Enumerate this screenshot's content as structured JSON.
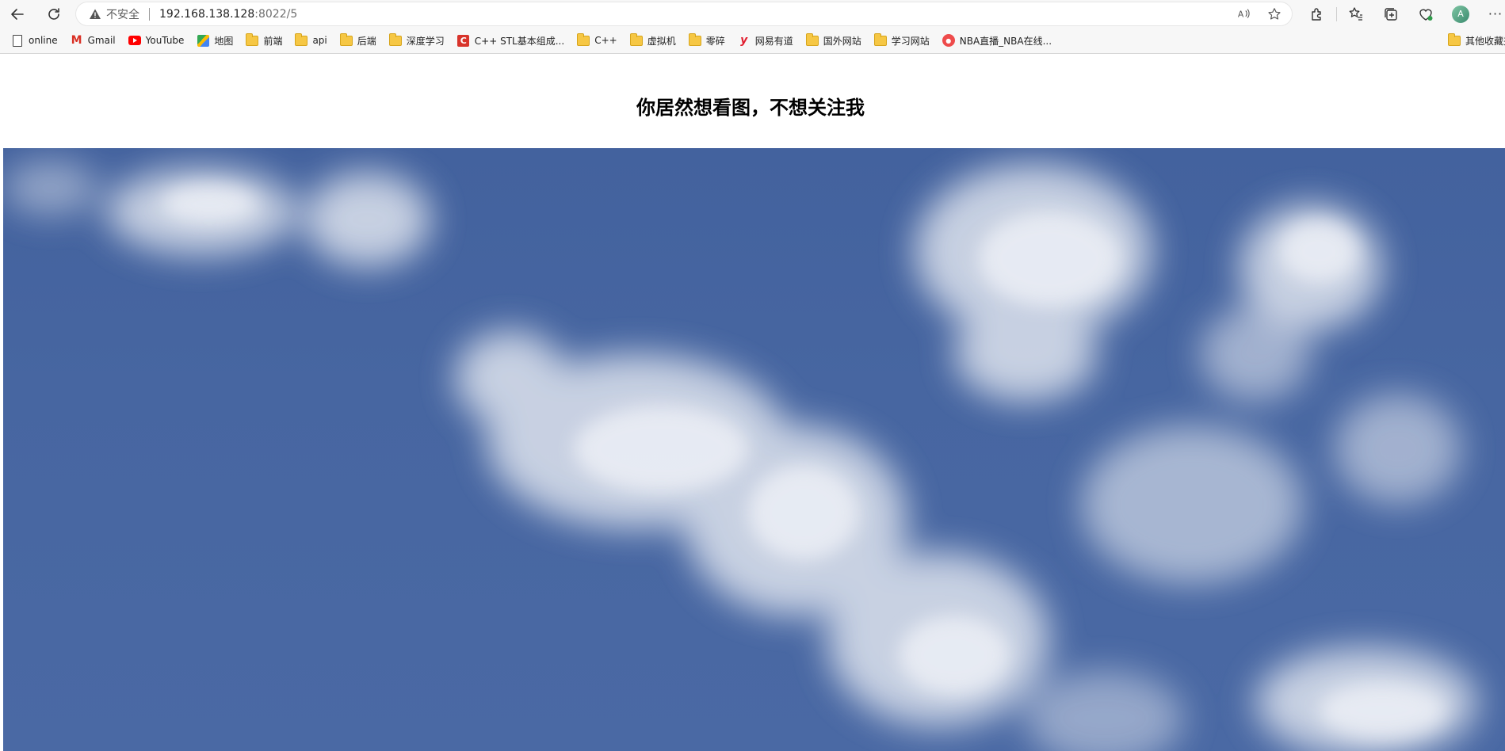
{
  "browser": {
    "security_label": "不安全",
    "url_host": "192.168.138.128",
    "url_rest": ":8022/5",
    "avatar_initial": "A"
  },
  "bookmarks": [
    {
      "label": "online",
      "icon": "page-icon"
    },
    {
      "label": "Gmail",
      "icon": "gmail-icon"
    },
    {
      "label": "YouTube",
      "icon": "youtube-icon"
    },
    {
      "label": "地图",
      "icon": "maps-icon"
    },
    {
      "label": "前端",
      "icon": "folder-icon"
    },
    {
      "label": "api",
      "icon": "folder-icon"
    },
    {
      "label": "后端",
      "icon": "folder-icon"
    },
    {
      "label": "深度学习",
      "icon": "folder-icon"
    },
    {
      "label": "C++ STL基本组成...",
      "icon": "cpp-reference-icon"
    },
    {
      "label": "C++",
      "icon": "folder-icon"
    },
    {
      "label": "虚拟机",
      "icon": "folder-icon"
    },
    {
      "label": "零碎",
      "icon": "folder-icon"
    },
    {
      "label": "网易有道",
      "icon": "youdao-icon"
    },
    {
      "label": "国外网站",
      "icon": "folder-icon"
    },
    {
      "label": "学习网站",
      "icon": "folder-icon"
    },
    {
      "label": "NBA直播_NBA在线...",
      "icon": "nba-icon"
    }
  ],
  "other_bookmarks": {
    "label": "其他收藏夹",
    "icon": "folder-icon"
  },
  "page": {
    "heading": "你居然想看图，不想关注我",
    "image_alt": "blue sky with white clouds"
  }
}
